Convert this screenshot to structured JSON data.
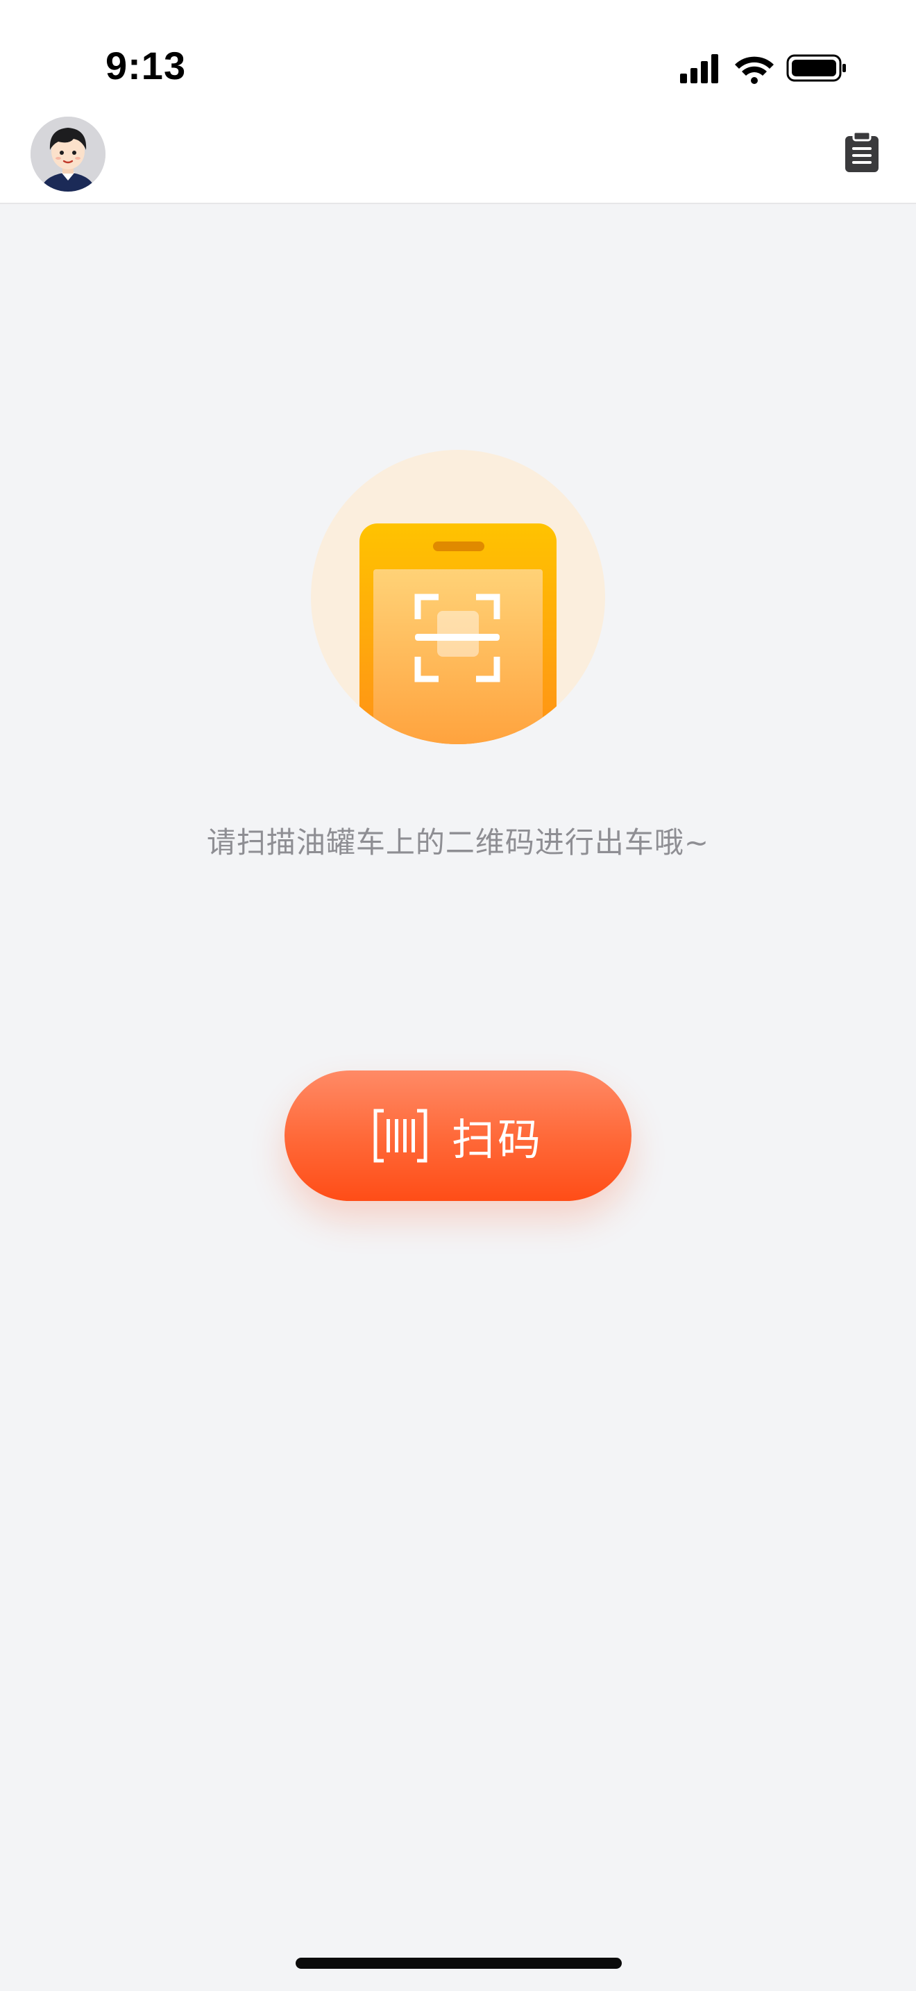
{
  "status_bar": {
    "time": "9:13",
    "icons": [
      "cellular-signal-icon",
      "wifi-icon",
      "battery-icon"
    ]
  },
  "header": {
    "avatar_icon": "user-avatar",
    "record_icon": "clipboard-list-icon"
  },
  "main": {
    "illustration_icon": "phone-scan-icon",
    "hint_text": "请扫描油罐车上的二维码进行出车哦~",
    "scan_button": {
      "label": "扫码",
      "icon": "barcode-scan-icon"
    }
  },
  "colors": {
    "accent": "#ff5a24",
    "illustration_bg": "#fbeedd",
    "illustration_phone": "#ffa500",
    "hint_text": "#8e8e93",
    "background": "#f3f4f6"
  }
}
